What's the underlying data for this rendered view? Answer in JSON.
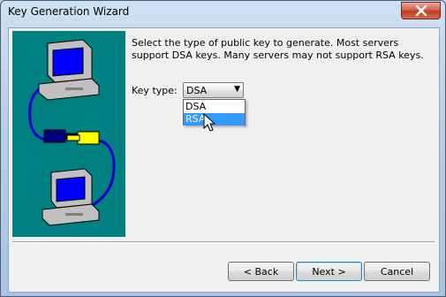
{
  "window": {
    "title": "Key Generation Wizard",
    "close_icon": "close-icon"
  },
  "content": {
    "intro_text": "Select the type of public key to generate.  Most servers support DSA keys.  Many servers may not support RSA keys.",
    "key_type_label": "Key type:",
    "key_type_value": "DSA",
    "key_type_options": [
      "DSA",
      "RSA"
    ],
    "highlighted_option": "RSA"
  },
  "buttons": {
    "back": "< Back",
    "next": "Next >",
    "cancel": "Cancel"
  },
  "colors": {
    "art_background": "#008080",
    "highlight": "#3399ff"
  }
}
